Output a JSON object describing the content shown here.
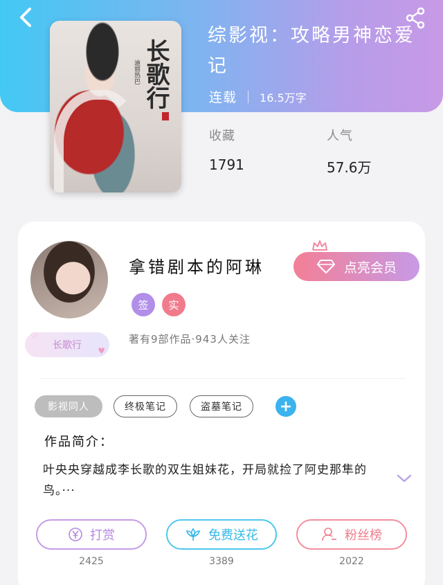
{
  "book": {
    "title": "综影视：攻略男神恋爱记",
    "status": "连载",
    "word_count": "16.5万字",
    "favorites_label": "收藏",
    "favorites_value": "1791",
    "popularity_label": "人气",
    "popularity_value": "57.6万",
    "cover_title": "长歌行",
    "cover_subtitle": "迪丽热巴"
  },
  "author": {
    "name": "拿错剧本的阿琳",
    "badges": [
      "签",
      "实"
    ],
    "stats": "著有9部作品·943人关注",
    "fan_tag": "长歌行",
    "vip_button": "点亮会员"
  },
  "tags": [
    "影视同人",
    "终极笔记",
    "盗墓笔记"
  ],
  "add_tag_symbol": "+",
  "intro": {
    "title": "作品简介：",
    "text": "叶央央穿越成李长歌的双生姐妹花，开局就捡了阿史那隼的鸟。···"
  },
  "actions": [
    {
      "label": "打赏",
      "count": "2425"
    },
    {
      "label": "免费送花",
      "count": "3389"
    },
    {
      "label": "粉丝榜",
      "count": "2022"
    }
  ],
  "colors": {
    "header_start": "#43c8f4",
    "header_end": "#c79ae6",
    "vip_start": "#f37f95",
    "tip": "#b488e0",
    "flower": "#36b8e6",
    "fans": "#ef7b8b"
  }
}
